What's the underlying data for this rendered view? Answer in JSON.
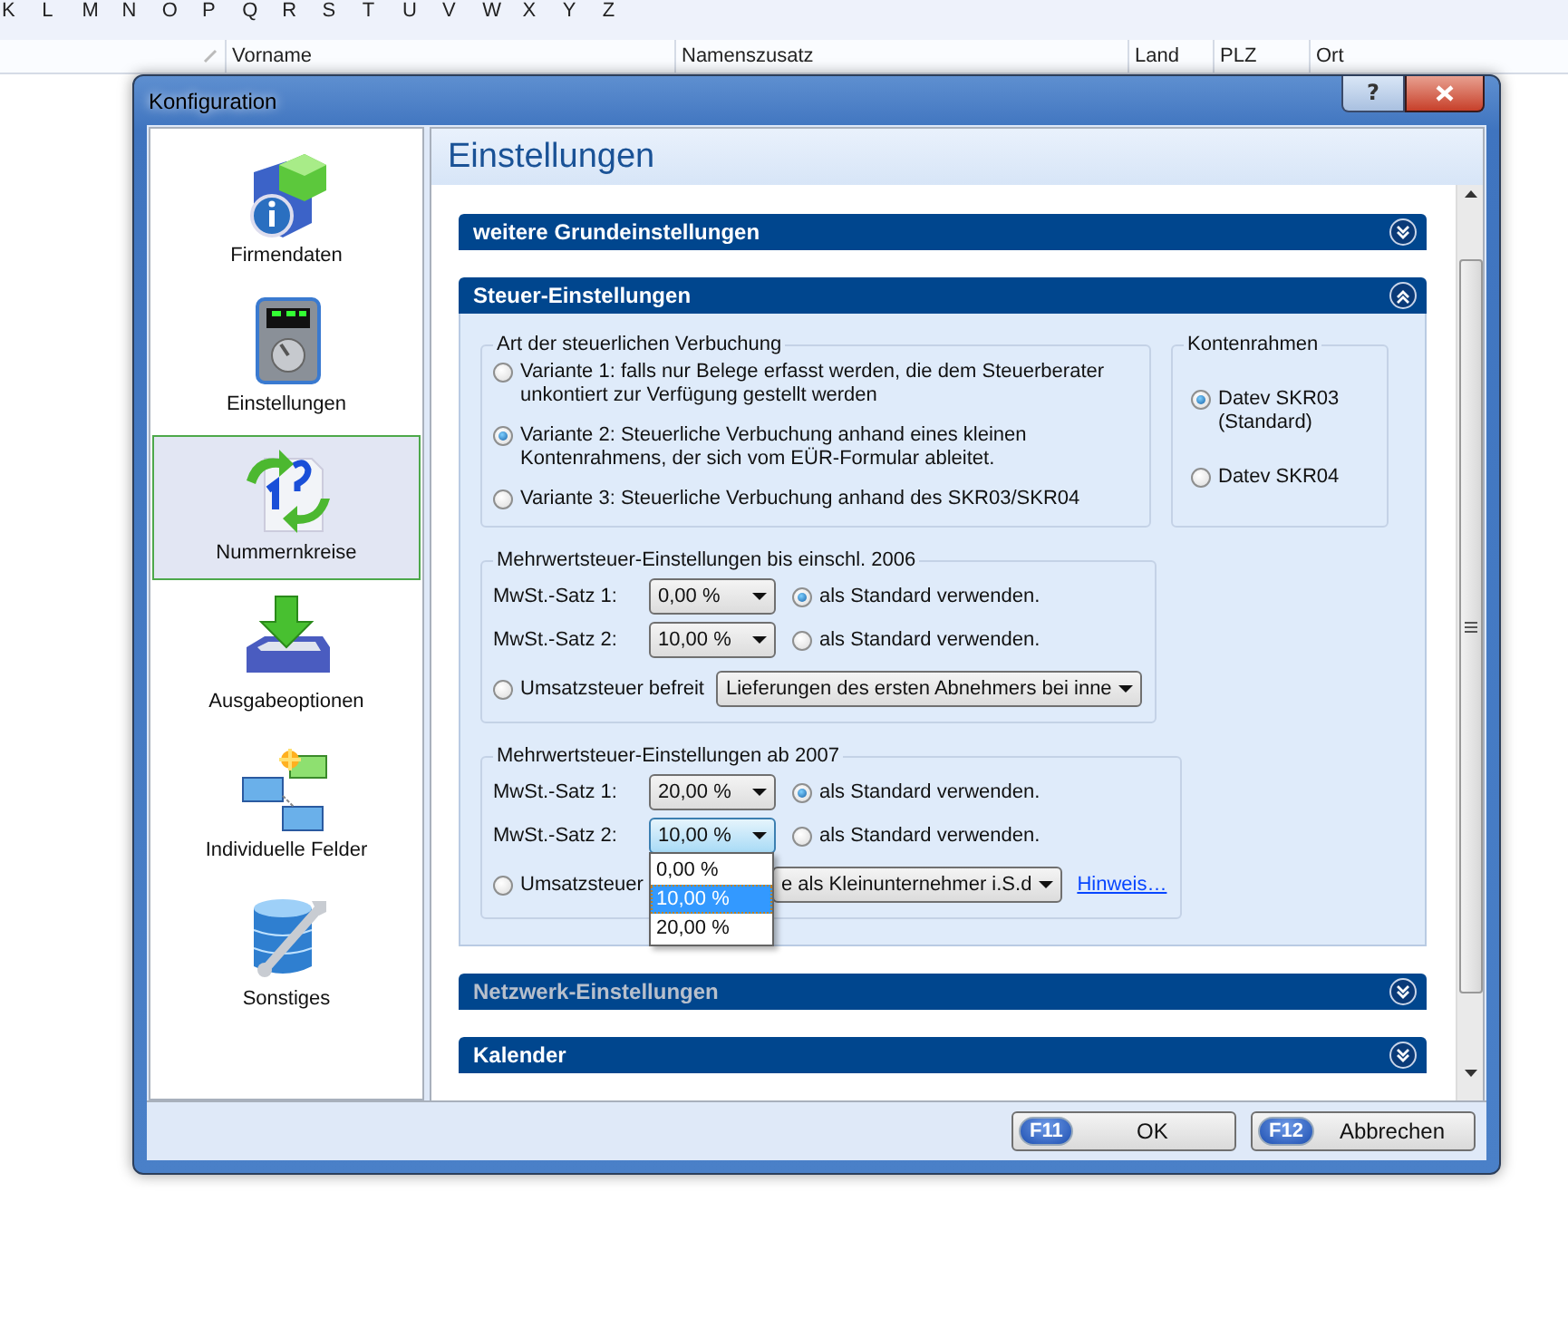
{
  "background": {
    "alphabet": [
      "K",
      "L",
      "M",
      "N",
      "O",
      "P",
      "Q",
      "R",
      "S",
      "T",
      "U",
      "V",
      "W",
      "X",
      "Y",
      "Z"
    ],
    "columns": [
      "Vorname",
      "Namenszusatz",
      "Land",
      "PLZ",
      "Ort"
    ]
  },
  "window": {
    "title": "Konfiguration",
    "help": "?"
  },
  "sidebar": {
    "items": [
      {
        "label": "Firmendaten",
        "kind": "company",
        "selected": false
      },
      {
        "label": "Einstellungen",
        "kind": "device",
        "selected": false
      },
      {
        "label": "Nummernkreise",
        "kind": "numbers",
        "selected": true
      },
      {
        "label": "Ausgabeoptionen",
        "kind": "output",
        "selected": false
      },
      {
        "label": "Individuelle Felder",
        "kind": "fields",
        "selected": false
      },
      {
        "label": "Sonstiges",
        "kind": "misc",
        "selected": false
      }
    ]
  },
  "content": {
    "title": "Einstellungen",
    "sections": [
      {
        "title": "weitere Grundeinstellungen",
        "expanded": false,
        "disabled": false
      },
      {
        "title": "Steuer-Einstellungen",
        "expanded": true,
        "disabled": false
      },
      {
        "title": "Netzwerk-Einstellungen",
        "expanded": false,
        "disabled": true
      },
      {
        "title": "Kalender",
        "expanded": false,
        "disabled": false
      }
    ],
    "tax": {
      "booking": {
        "title": "Art der steuerlichen Verbuchung",
        "options": [
          {
            "label": "Variante 1: falls nur Belege erfasst werden, die dem Steuerberater unkontiert zur Verfügung gestellt werden",
            "selected": false
          },
          {
            "label": "Variante 2: Steuerliche Verbuchung anhand eines kleinen Kontenrahmens, der sich vom EÜR-Formular ableitet.",
            "selected": true
          },
          {
            "label": "Variante 3: Steuerliche Verbuchung anhand des SKR03/SKR04",
            "selected": false
          }
        ]
      },
      "chart_of_accounts": {
        "title": "Kontenrahmen",
        "options": [
          {
            "label": "Datev SKR03 (Standard)",
            "selected": true
          },
          {
            "label": "Datev SKR04",
            "selected": false
          }
        ]
      },
      "vat_groups": [
        {
          "title": "Mehrwertsteuer-Einstellungen bis einschl. 2006",
          "rates": [
            {
              "label": "MwSt.-Satz 1:",
              "value": "0,00 %",
              "focused": false,
              "default_label": "als Standard verwenden.",
              "default": true
            },
            {
              "label": "MwSt.-Satz 2:",
              "value": "10,00 %",
              "focused": false,
              "default_label": "als Standard verwenden.",
              "default": false
            }
          ],
          "exempt": {
            "label": "Umsatzsteuer befreit",
            "checked": false,
            "value": "Lieferungen des ersten Abnehmers bei inne"
          }
        },
        {
          "title": "Mehrwertsteuer-Einstellungen ab 2007",
          "rates": [
            {
              "label": "MwSt.-Satz 1:",
              "value": "20,00 %",
              "focused": false,
              "default_label": "als Standard verwenden.",
              "default": true
            },
            {
              "label": "MwSt.-Satz 2:",
              "value": "10,00 %",
              "focused": true,
              "default_label": "als Standard verwenden.",
              "default": false,
              "dropdown": [
                {
                  "label": "0,00 %",
                  "selected": false
                },
                {
                  "label": "10,00 %",
                  "selected": true
                },
                {
                  "label": "20,00 %",
                  "selected": false
                }
              ]
            }
          ],
          "exempt": {
            "label": "Umsatzsteuer",
            "checked": false,
            "value": "e als Kleinunternehmer i.S.d",
            "link": "Hinweis…"
          }
        }
      ]
    }
  },
  "footer_buttons": [
    {
      "key": "F11",
      "label": "OK"
    },
    {
      "key": "F12",
      "label": "Abbrechen"
    }
  ]
}
